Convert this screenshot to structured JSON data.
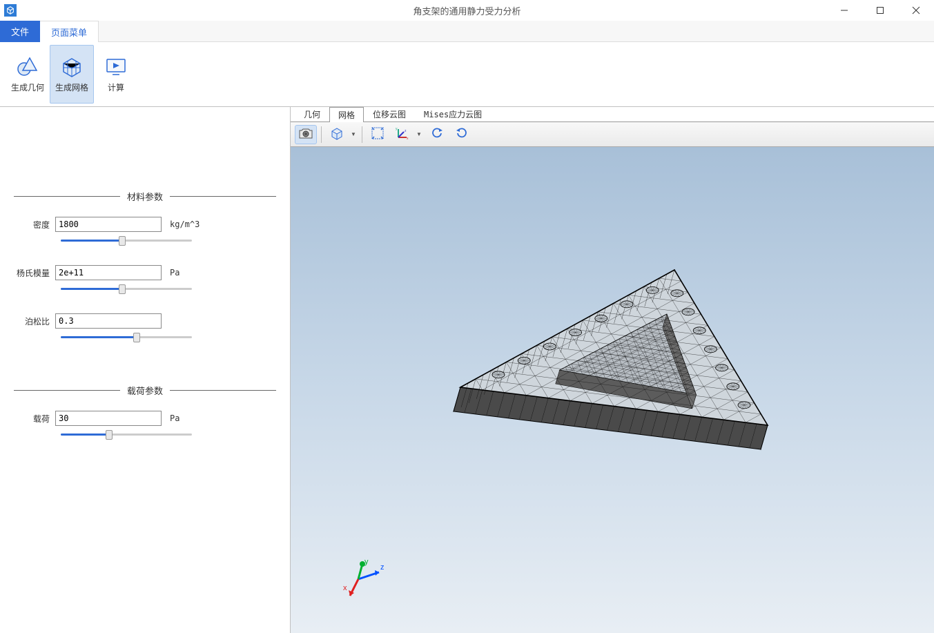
{
  "window": {
    "title": "角支架的通用静力受力分析"
  },
  "menubar": {
    "file": "文件",
    "page_menu": "页面菜单"
  },
  "ribbon": {
    "geometry": "生成几何",
    "mesh": "生成网格",
    "compute": "计算"
  },
  "sidebar": {
    "material_section": "材料参数",
    "load_section": "载荷参数",
    "density": {
      "label": "密度",
      "value": "1800",
      "unit": "kg/m^3",
      "slider_pct": 47
    },
    "youngs": {
      "label": "杨氏模量",
      "value": "2e+11",
      "unit": "Pa",
      "slider_pct": 47
    },
    "poisson": {
      "label": "泊松比",
      "value": "0.3",
      "unit": "",
      "slider_pct": 58
    },
    "load": {
      "label": "载荷",
      "value": "30",
      "unit": "Pa",
      "slider_pct": 37
    }
  },
  "viewport": {
    "tabs": {
      "geometry": "几何",
      "mesh": "网格",
      "displacement": "位移云图",
      "mises": "Mises应力云图"
    },
    "triad": {
      "x": "x",
      "y": "y",
      "z": "z"
    }
  }
}
